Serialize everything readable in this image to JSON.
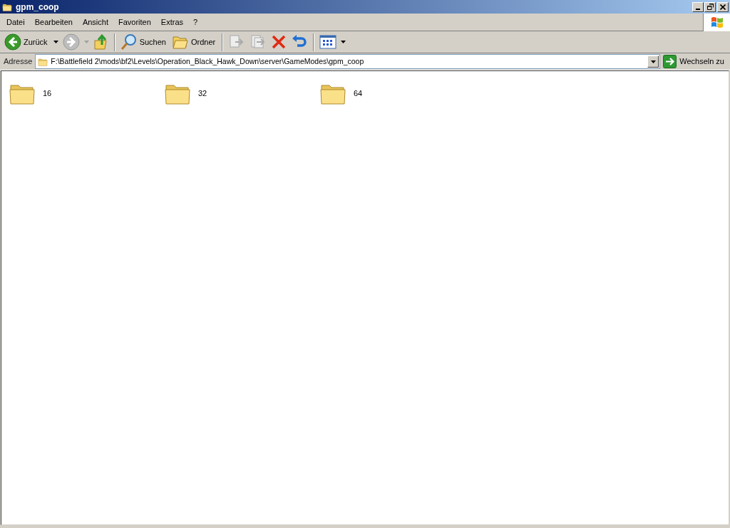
{
  "window": {
    "title": "gpm_coop"
  },
  "menu": [
    "Datei",
    "Bearbeiten",
    "Ansicht",
    "Favoriten",
    "Extras",
    "?"
  ],
  "toolbar": [
    {
      "kind": "back",
      "label": "Zurück",
      "disabled": false
    },
    {
      "kind": "forward",
      "disabled": true
    },
    {
      "kind": "up",
      "disabled": false
    },
    {
      "kind": "separator"
    },
    {
      "kind": "search",
      "label": "Suchen",
      "disabled": false
    },
    {
      "kind": "folders",
      "label": "Ordner",
      "disabled": false
    },
    {
      "kind": "separator"
    },
    {
      "kind": "move",
      "disabled": true
    },
    {
      "kind": "copy",
      "disabled": true
    },
    {
      "kind": "delete",
      "disabled": false
    },
    {
      "kind": "undo",
      "disabled": false
    },
    {
      "kind": "separator"
    },
    {
      "kind": "views",
      "disabled": false
    }
  ],
  "address": {
    "label": "Adresse",
    "value": "F:\\Battlefield 2\\mods\\bf2\\Levels\\Operation_Black_Hawk_Down\\server\\GameModes\\gpm_coop",
    "go": "Wechseln zu"
  },
  "items": [
    {
      "name": "16",
      "selected": false
    },
    {
      "name": "32",
      "selected": false
    },
    {
      "name": "64",
      "selected": false
    }
  ]
}
